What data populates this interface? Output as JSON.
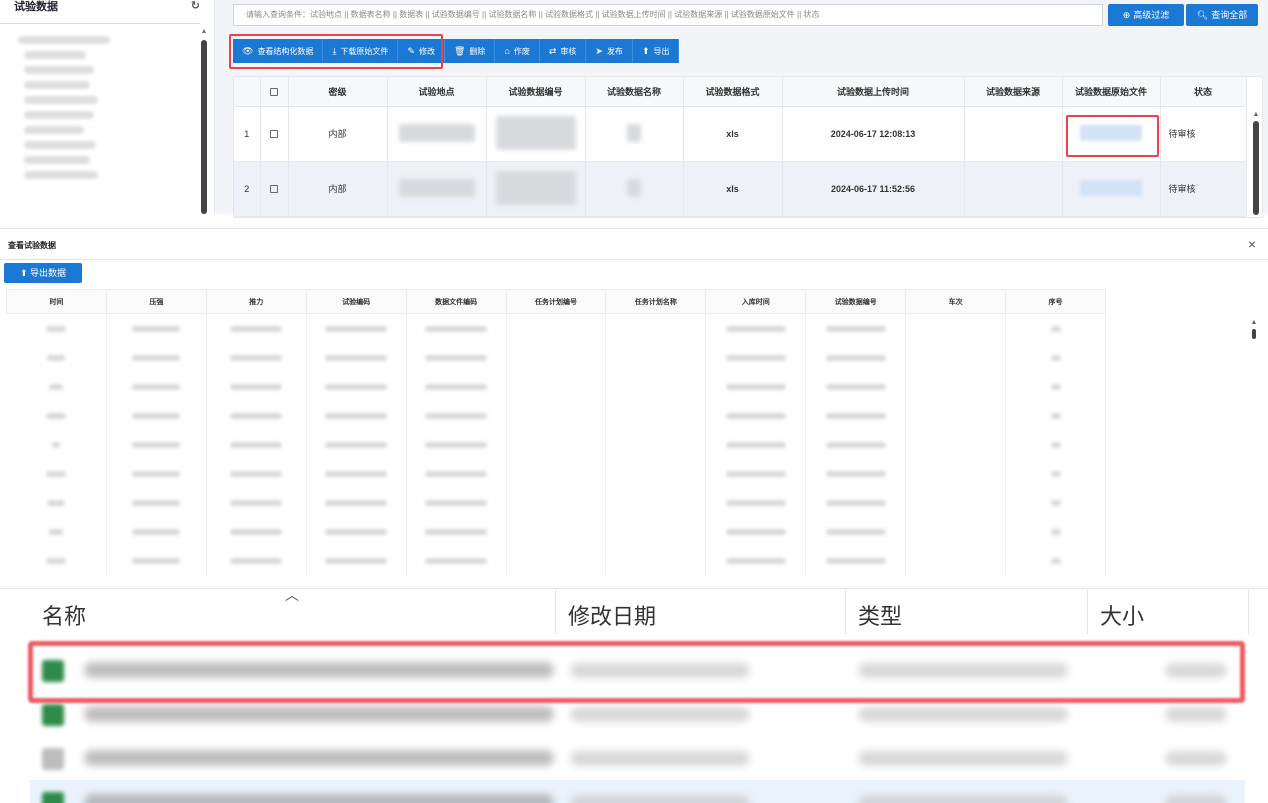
{
  "sidebar": {
    "title": "试验数据",
    "refresh_icon": "refresh-icon",
    "blurred_node_count": 10
  },
  "search": {
    "placeholder": "请输入查询条件：试验地点 || 数据表名称 || 数据表 || 试验数据编号 || 试验数据名称 || 试验数据格式 || 试验数据上传时间 || 试验数据来源 || 试验数据原始文件 || 状态",
    "advanced_filter_label": "高级过滤",
    "query_all_label": "查询全部"
  },
  "toolbar": {
    "buttons": [
      {
        "name": "view-structured-data-button",
        "icon": "eye-icon",
        "glyph": "👁",
        "label": "查看结构化数据"
      },
      {
        "name": "download-original-file-button",
        "icon": "download-icon",
        "glyph": "⤓",
        "label": "下载原始文件"
      },
      {
        "name": "edit-button",
        "icon": "edit-icon",
        "glyph": "✎",
        "label": "修改"
      },
      {
        "name": "delete-button",
        "icon": "trash-icon",
        "glyph": "🗑",
        "label": "删除"
      },
      {
        "name": "void-button",
        "icon": "bank-icon",
        "glyph": "⌂",
        "label": "作废"
      },
      {
        "name": "review-button",
        "icon": "retweet-icon",
        "glyph": "⇄",
        "label": "审核"
      },
      {
        "name": "publish-button",
        "icon": "send-icon",
        "glyph": "➤",
        "label": "发布"
      },
      {
        "name": "export-button",
        "icon": "circle-arrow-up-icon",
        "glyph": "⬆",
        "label": "导出"
      }
    ]
  },
  "grid": {
    "columns": [
      "",
      "",
      "密级",
      "试验地点",
      "试验数据编号",
      "试验数据名称",
      "试验数据格式",
      "试验数据上传时间",
      "试验数据来源",
      "试验数据原始文件",
      "状态"
    ],
    "rows": [
      {
        "index": "1",
        "security": "内部",
        "format": "xls",
        "upload_time": "2024-06-17 12:08:13",
        "source": "",
        "status": "待审核"
      },
      {
        "index": "2",
        "security": "内部",
        "format": "xls",
        "upload_time": "2024-06-17 11:52:56",
        "source": "",
        "status": "待审核"
      }
    ]
  },
  "dialog": {
    "title": "查看试验数据",
    "close_icon": "close-icon",
    "export_label": "导出数据",
    "columns": [
      "时间",
      "压强",
      "推力",
      "试验编码",
      "数据文件编码",
      "任务计划编号",
      "任务计划名称",
      "入库时间",
      "试验数据编号",
      "车次",
      "序号"
    ],
    "blurred_row_count": 9
  },
  "explorer": {
    "columns": [
      "名称",
      "修改日期",
      "类型",
      "大小"
    ],
    "rows": [
      {
        "icon": "excel-file-icon",
        "selected": true
      },
      {
        "icon": "excel-file-icon",
        "selected": false
      },
      {
        "icon": "generic-file-icon",
        "selected": false
      },
      {
        "icon": "excel-file-icon",
        "selected": false
      }
    ]
  },
  "colors": {
    "primary": "#1b79d5",
    "highlight_red": "#e8444b",
    "security_green": "#4c9a3d",
    "pending_status": "#b33a66"
  }
}
